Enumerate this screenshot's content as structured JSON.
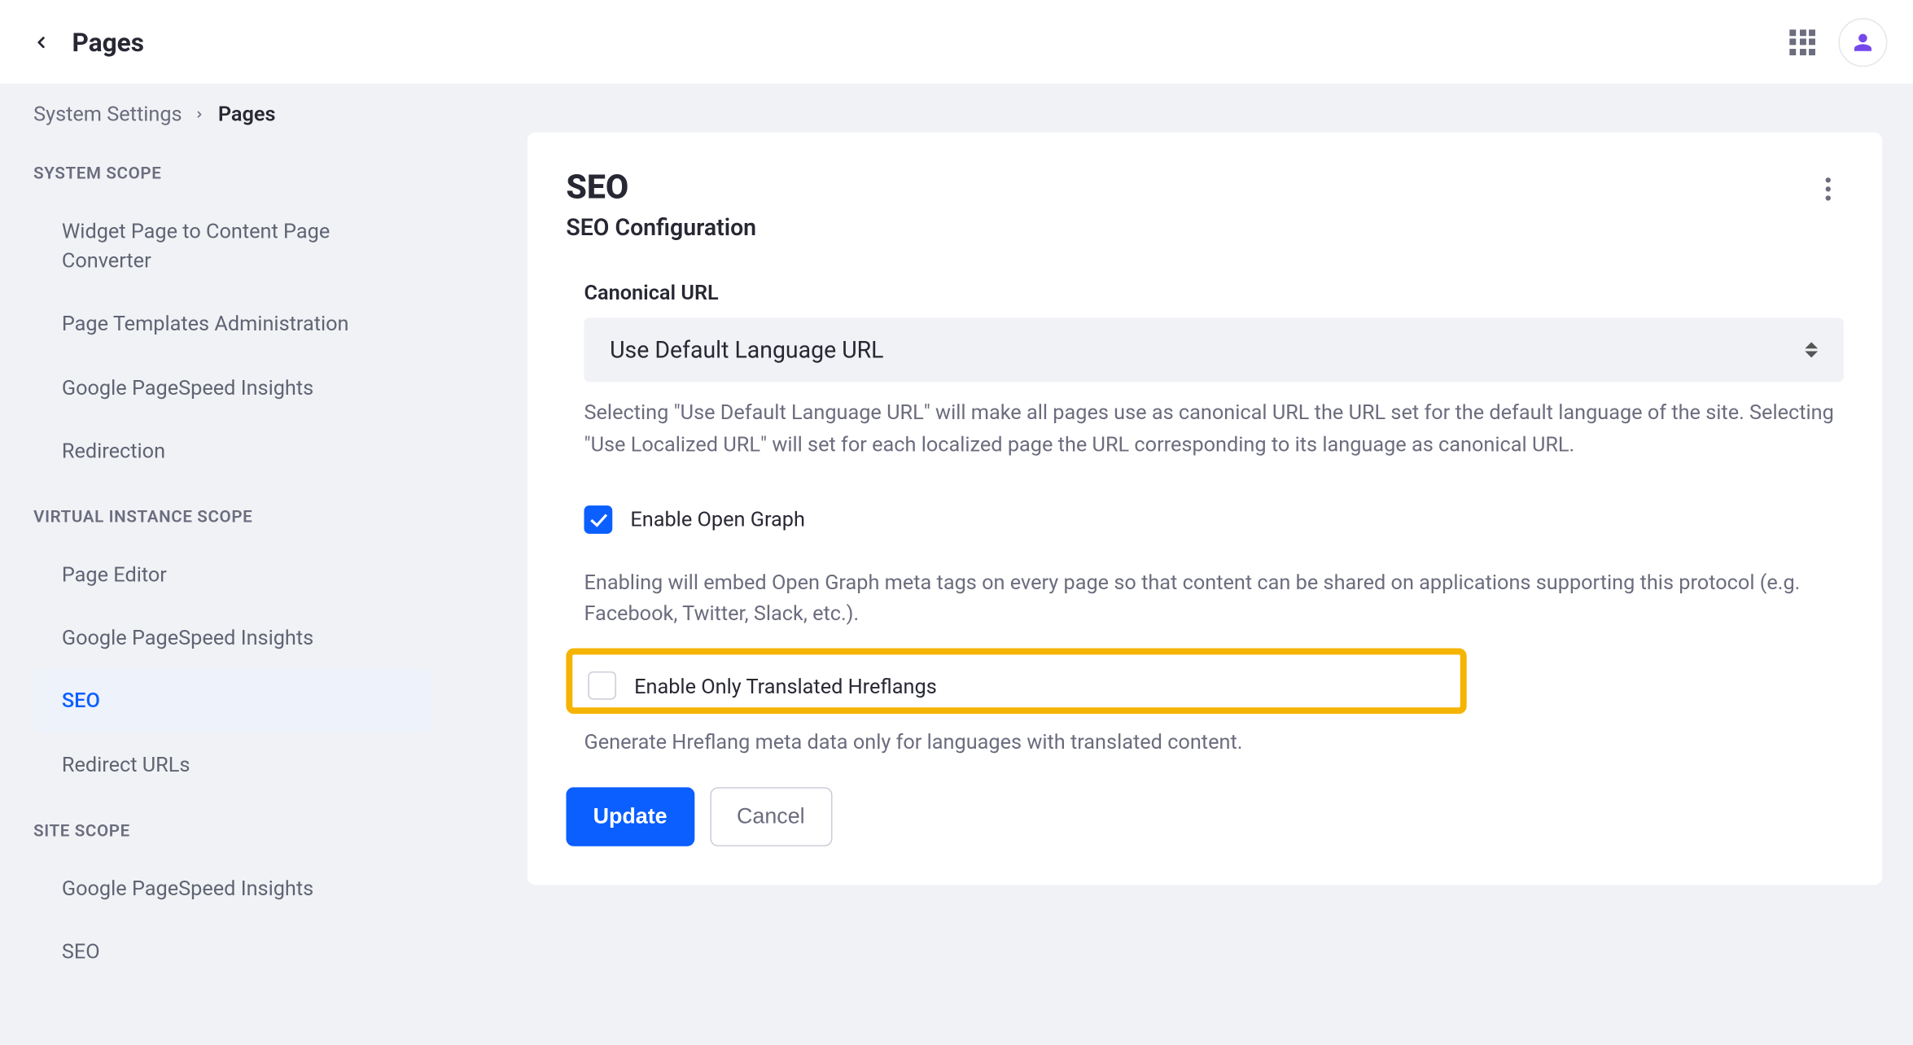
{
  "topbar": {
    "title": "Pages"
  },
  "breadcrumb": {
    "parent": "System Settings",
    "current": "Pages"
  },
  "sidebar": {
    "sections": [
      {
        "label": "SYSTEM SCOPE",
        "items": [
          "Widget Page to Content Page Converter",
          "Page Templates Administration",
          "Google PageSpeed Insights",
          "Redirection"
        ]
      },
      {
        "label": "VIRTUAL INSTANCE SCOPE",
        "items": [
          "Page Editor",
          "Google PageSpeed Insights",
          "SEO",
          "Redirect URLs"
        ]
      },
      {
        "label": "SITE SCOPE",
        "items": [
          "Google PageSpeed Insights",
          "SEO"
        ]
      }
    ]
  },
  "main": {
    "heading": "SEO",
    "subtitle": "SEO Configuration",
    "canonical": {
      "label": "Canonical URL",
      "value": "Use Default Language URL",
      "help": "Selecting \"Use Default Language URL\" will make all pages use as canonical URL the URL set for the default language of the site. Selecting \"Use Localized URL\" will set for each localized page the URL corresponding to its language as canonical URL."
    },
    "opengraph": {
      "label": "Enable Open Graph",
      "help": "Enabling will embed Open Graph meta tags on every page so that content can be shared on applications supporting this protocol (e.g. Facebook, Twitter, Slack, etc.)."
    },
    "hreflang": {
      "label": "Enable Only Translated Hreflangs",
      "help": "Generate Hreflang meta data only for languages with translated content."
    },
    "buttons": {
      "update": "Update",
      "cancel": "Cancel"
    }
  }
}
